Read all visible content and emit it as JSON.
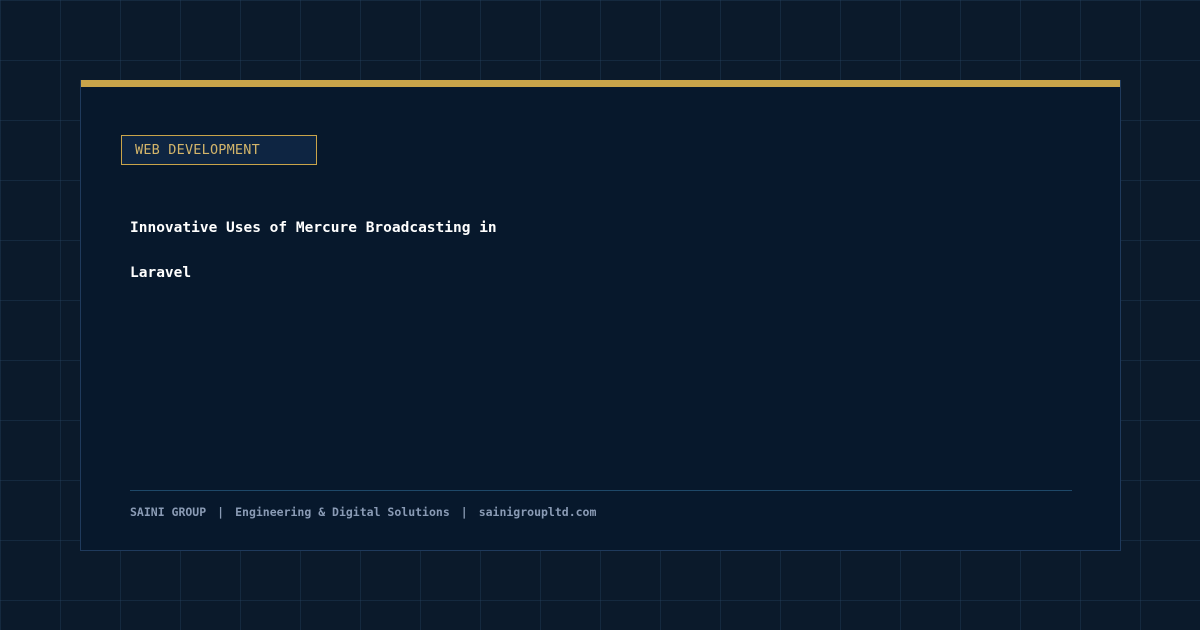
{
  "category": "WEB DEVELOPMENT",
  "title": {
    "line1": "Innovative Uses of Mercure Broadcasting in",
    "line2": "Laravel"
  },
  "footer": {
    "company": "SAINI GROUP",
    "separator": "|",
    "tagline": "Engineering & Digital Solutions",
    "website": "sainigroupltd.com"
  },
  "colors": {
    "background": "#0b1a2b",
    "card": "#07182c",
    "accent": "#c9a44a",
    "title": "#ffffff",
    "footer_text": "#8a9bb5"
  }
}
